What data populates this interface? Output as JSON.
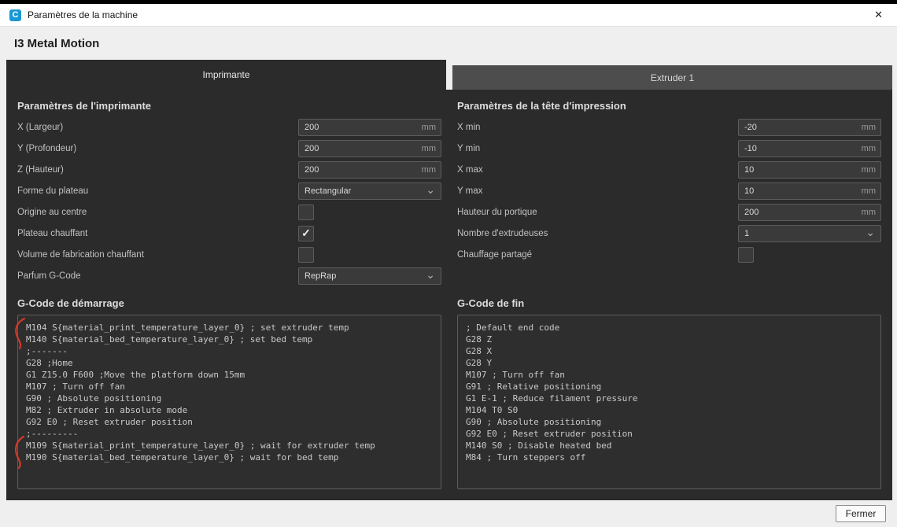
{
  "window": {
    "title": "Paramètres de la machine"
  },
  "machine_name": "I3 Metal Motion",
  "tabs": {
    "printer": "Imprimante",
    "extruder": "Extruder 1"
  },
  "icons": {
    "close": "✕",
    "chevron": "⌄",
    "check": "✓"
  },
  "printer": {
    "section_title": "Paramètres de l'imprimante",
    "x_width": {
      "label": "X (Largeur)",
      "value": "200",
      "unit": "mm"
    },
    "y_depth": {
      "label": "Y (Profondeur)",
      "value": "200",
      "unit": "mm"
    },
    "z_height": {
      "label": "Z (Hauteur)",
      "value": "200",
      "unit": "mm"
    },
    "build_plate_shape": {
      "label": "Forme du plateau",
      "value": "Rectangular"
    },
    "origin_at_center": {
      "label": "Origine au centre",
      "checked": false
    },
    "heated_bed": {
      "label": "Plateau chauffant",
      "checked": true
    },
    "heated_build_volume": {
      "label": "Volume de fabrication chauffant",
      "checked": false
    },
    "gcode_flavor": {
      "label": "Parfum G-Code",
      "value": "RepRap"
    }
  },
  "printhead": {
    "section_title": "Paramètres de la tête d'impression",
    "x_min": {
      "label": "X min",
      "value": "-20",
      "unit": "mm"
    },
    "y_min": {
      "label": "Y min",
      "value": "-10",
      "unit": "mm"
    },
    "x_max": {
      "label": "X max",
      "value": "10",
      "unit": "mm"
    },
    "y_max": {
      "label": "Y max",
      "value": "10",
      "unit": "mm"
    },
    "gantry_height": {
      "label": "Hauteur du portique",
      "value": "200",
      "unit": "mm"
    },
    "extruder_count": {
      "label": "Nombre d'extrudeuses",
      "value": "1"
    },
    "shared_heater": {
      "label": "Chauffage partagé",
      "checked": false
    }
  },
  "start_gcode": {
    "section_title": "G-Code de démarrage",
    "code": "M104 S{material_print_temperature_layer_0} ; set extruder temp\nM140 S{material_bed_temperature_layer_0} ; set bed temp\n;-------\nG28 ;Home\nG1 Z15.0 F600 ;Move the platform down 15mm\nM107 ; Turn off fan\nG90 ; Absolute positioning\nM82 ; Extruder in absolute mode\nG92 E0 ; Reset extruder position\n;---------\nM109 S{material_print_temperature_layer_0} ; wait for extruder temp\nM190 S{material_bed_temperature_layer_0} ; wait for bed temp"
  },
  "end_gcode": {
    "section_title": "G-Code de fin",
    "code": "; Default end code\nG28 Z\nG28 X\nG28 Y\nM107 ; Turn off fan\nG91 ; Relative positioning\nG1 E-1 ; Reduce filament pressure\nM104 T0 S0\nG90 ; Absolute positioning\nG92 E0 ; Reset extruder position\nM140 S0 ; Disable heated bed\nM84 ; Turn steppers off"
  },
  "footer": {
    "close_button": "Fermer"
  }
}
